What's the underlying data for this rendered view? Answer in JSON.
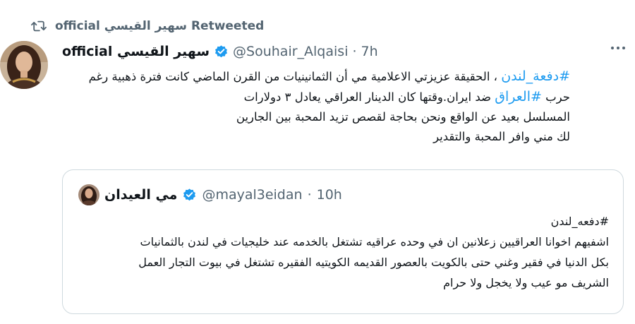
{
  "retweet": {
    "icon": "retweet-icon",
    "text": "official سهير القيسي Retweeted"
  },
  "tweet": {
    "avatar_icon": "profile-photo",
    "display_name": "official سهير القيسي",
    "verified_icon": "verified-badge-icon",
    "handle": "@Souhair_Alqaisi",
    "separator": "·",
    "time": "7h",
    "more_icon": "more-options-icon",
    "body": {
      "line1_hashtag": "#دفعة_لندن",
      "line1_text": " ، الحقيقة عزيزتي الاعلامية مي أن الثمانينيات من القرن الماضي كانت فترة ذهبية رغم",
      "line2_prefix": "حرب ",
      "line2_hashtag": "#العراق",
      "line2_text": " ضد ايران.وقتها كان الدينار العراقي يعادل ٣ دولارات",
      "line3": "المسلسل بعيد عن الواقع ونحن بحاجة لقصص تزيد المحبة بين الجارين",
      "line4": "لك مني وافر المحبة والتقدير"
    }
  },
  "quoted": {
    "avatar_icon": "profile-photo",
    "display_name": "مي العيدان",
    "verified_icon": "verified-badge-icon",
    "handle": "@mayal3eidan",
    "separator": "·",
    "time": "10h",
    "body": {
      "line1": "#دفعه_لندن",
      "line2": "اشفيهم اخوانا العراقيين زعلانين ان في وحده عراقيه تشتغل بالخدمه عند خليجيات في لندن بالثمانيات",
      "line3": "بكل الدنيا في فقير وغني حتى بالكويت بالعصور القديمه الكويتيه الفقيره تشتغل في بيوت التجار العمل",
      "line4": "الشريف مو عيب ولا يخجل ولا حرام"
    }
  },
  "colors": {
    "link": "#1d9bf0",
    "secondary_text": "#536471",
    "primary_text": "#0f1419",
    "border": "#cfd9de",
    "verified": "#1d9bf0"
  }
}
